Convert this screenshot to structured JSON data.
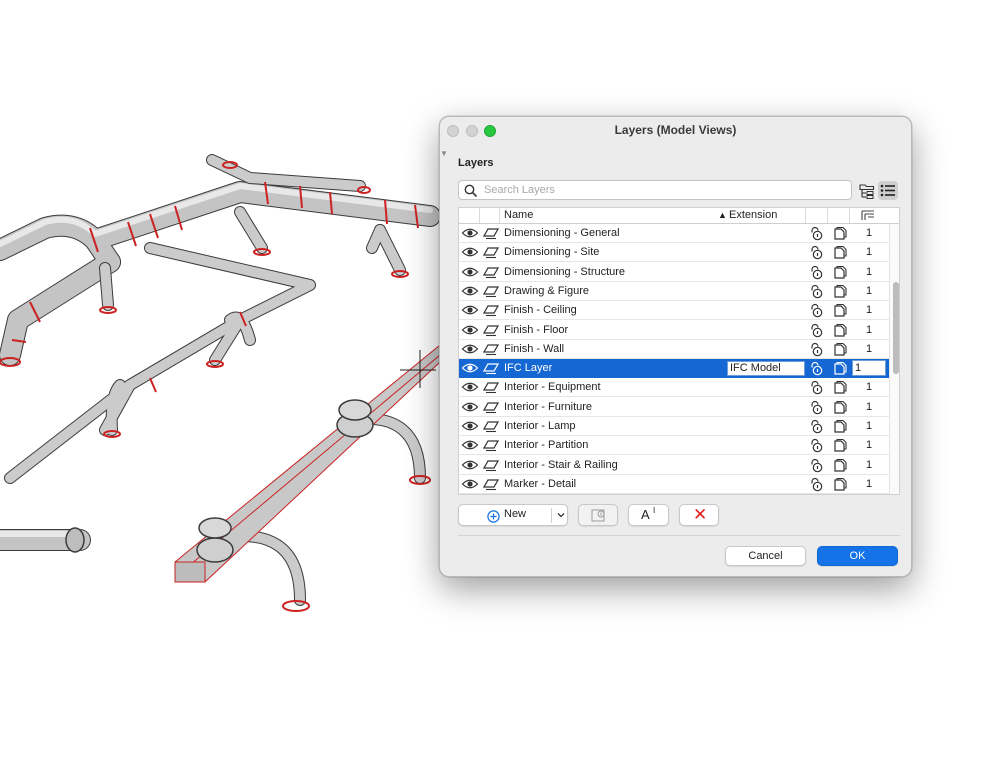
{
  "dialog": {
    "title": "Layers (Model Views)",
    "section_label": "Layers",
    "search_placeholder": "Search Layers"
  },
  "table": {
    "headers": {
      "name": "Name",
      "extension": "Extension"
    },
    "rows": [
      {
        "name": "Dimensioning - General",
        "extension": "",
        "num": "1",
        "selected": false
      },
      {
        "name": "Dimensioning - Site",
        "extension": "",
        "num": "1",
        "selected": false
      },
      {
        "name": "Dimensioning - Structure",
        "extension": "",
        "num": "1",
        "selected": false
      },
      {
        "name": "Drawing & Figure",
        "extension": "",
        "num": "1",
        "selected": false
      },
      {
        "name": "Finish - Ceiling",
        "extension": "",
        "num": "1",
        "selected": false
      },
      {
        "name": "Finish - Floor",
        "extension": "",
        "num": "1",
        "selected": false
      },
      {
        "name": "Finish - Wall",
        "extension": "",
        "num": "1",
        "selected": false
      },
      {
        "name": "IFC Layer",
        "extension": "IFC Model",
        "num": "1",
        "selected": true
      },
      {
        "name": "Interior - Equipment",
        "extension": "",
        "num": "1",
        "selected": false
      },
      {
        "name": "Interior - Furniture",
        "extension": "",
        "num": "1",
        "selected": false
      },
      {
        "name": "Interior - Lamp",
        "extension": "",
        "num": "1",
        "selected": false
      },
      {
        "name": "Interior - Partition",
        "extension": "",
        "num": "1",
        "selected": false
      },
      {
        "name": "Interior - Stair & Railing",
        "extension": "",
        "num": "1",
        "selected": false
      },
      {
        "name": "Marker - Detail",
        "extension": "",
        "num": "1",
        "selected": false
      }
    ]
  },
  "buttons": {
    "new": "New",
    "font": "A",
    "font_sup": "I",
    "delete": "✕",
    "cancel": "Cancel",
    "ok": "OK"
  },
  "icons": {
    "search": "magnifier-icon",
    "folder_view": "folder-tree-icon",
    "list_view": "list-view-icon",
    "eye": "eye-icon",
    "layer": "layer-plane-icon",
    "lock": "lock-icon",
    "page": "page-icon"
  },
  "colors": {
    "selection": "#1567d3",
    "ok_button": "#1473e6",
    "delete_x": "#e01e1e",
    "pipe_outline": "#cc2222"
  }
}
